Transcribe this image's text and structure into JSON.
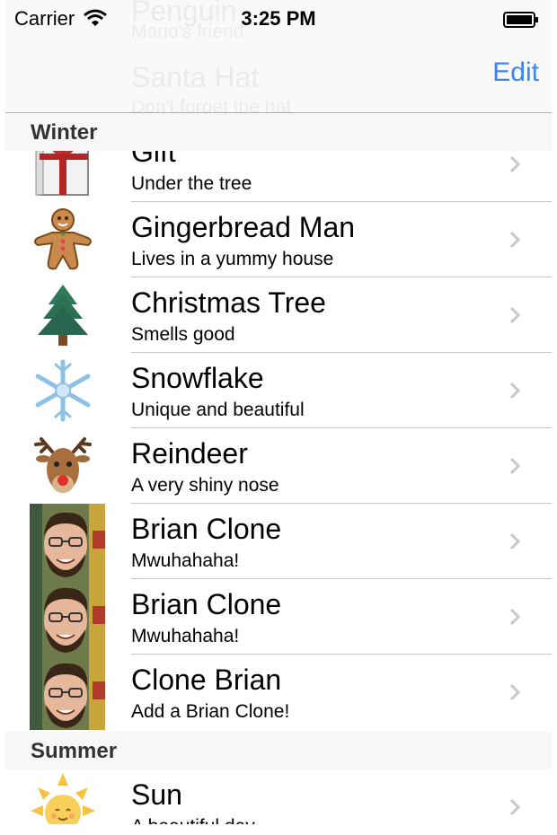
{
  "status_bar": {
    "carrier": "Carrier",
    "time": "3:25 PM"
  },
  "nav": {
    "edit_label": "Edit"
  },
  "behind_nav": [
    {
      "title": "Penguin",
      "subtitle": "Mario's friend"
    },
    {
      "title": "Santa Hat",
      "subtitle": "Don't forget the hat"
    }
  ],
  "sections": [
    {
      "header": "Winter",
      "rows": [
        {
          "title": "Gift",
          "subtitle": "Under the tree",
          "icon": "gift-icon"
        },
        {
          "title": "Gingerbread Man",
          "subtitle": "Lives in a yummy house",
          "icon": "gingerbread-man-icon"
        },
        {
          "title": "Christmas Tree",
          "subtitle": "Smells good",
          "icon": "christmas-tree-icon"
        },
        {
          "title": "Snowflake",
          "subtitle": "Unique and beautiful",
          "icon": "snowflake-icon"
        },
        {
          "title": "Reindeer",
          "subtitle": "A very shiny nose",
          "icon": "reindeer-icon"
        },
        {
          "title": "Brian Clone",
          "subtitle": "Mwuhahaha!",
          "icon": "brian-photo"
        },
        {
          "title": "Brian Clone",
          "subtitle": "Mwuhahaha!",
          "icon": "brian-photo"
        },
        {
          "title": "Clone Brian",
          "subtitle": "Add a Brian Clone!",
          "icon": "brian-photo"
        }
      ]
    },
    {
      "header": "Summer",
      "rows": [
        {
          "title": "Sun",
          "subtitle": "A beautiful day",
          "icon": "sun-icon"
        }
      ]
    }
  ],
  "colors": {
    "tint": "#3a86f0",
    "separator": "#c8c7cc",
    "section_bg": "#f7f7f7"
  }
}
